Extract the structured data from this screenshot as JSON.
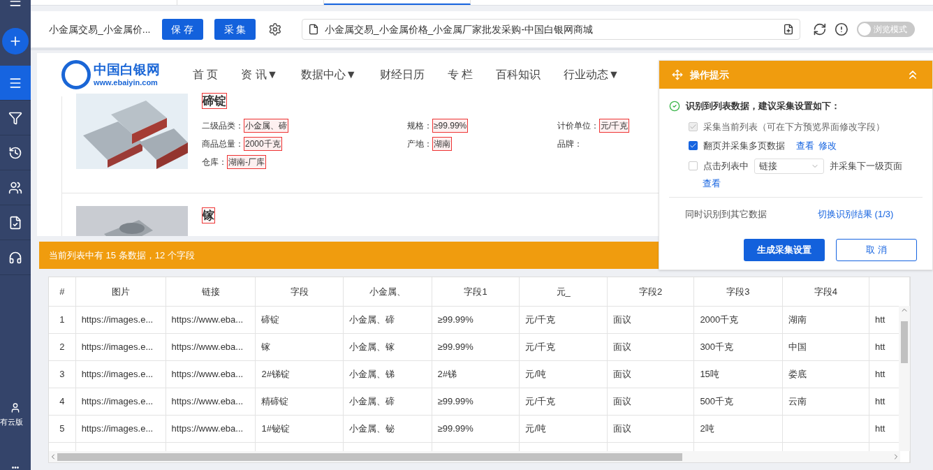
{
  "top_tabs": [
    {
      "selected": false
    },
    {
      "selected": false
    },
    {
      "selected": true
    }
  ],
  "toolbar": {
    "task_name": "小金属交易_小金属价...",
    "save": "保 存",
    "collect": "采 集",
    "url": "小金属交易_小金属价格_小金属厂家批发采购-中国白银网商城",
    "browse_mode": {
      "label": "浏览模式",
      "on": false
    }
  },
  "sidebar": {
    "items": [
      {
        "kind": "add"
      },
      {
        "kind": "list",
        "selected": true
      },
      {
        "kind": "filter",
        "selected": false
      },
      {
        "kind": "history",
        "selected": false
      },
      {
        "kind": "users",
        "selected": false
      },
      {
        "kind": "doc",
        "selected": false
      },
      {
        "kind": "support",
        "selected": false
      }
    ],
    "account": "有云版",
    "more": "•••"
  },
  "site": {
    "logo_name": "中国白银网",
    "logo_url": "www.ebaiyin.com",
    "nav": [
      "首 页",
      "资 讯▼",
      "数据中心▼",
      "财经日历",
      "专 栏",
      "百科知识",
      "行业动态▼"
    ]
  },
  "products": [
    {
      "title": "碲锭",
      "fields": [
        {
          "label": "二级品类：",
          "value": "小金属、碲"
        },
        {
          "label": "规格：",
          "value": "≥99.99%"
        },
        {
          "label": "计价单位：",
          "value": "元/千克"
        },
        {
          "label": "商品总量：",
          "value": "2000千克"
        },
        {
          "label": "产地：",
          "value": "湖南"
        },
        {
          "label": "品牌："
        },
        {
          "label": "仓库：",
          "value": "湖南-厂库"
        }
      ]
    },
    {
      "title": "镓"
    }
  ],
  "summary": "当前列表中有 15 条数据，12 个字段",
  "hint_panel": {
    "title": "操作提示",
    "status": "识别到列表数据，建议采集设置如下：",
    "options": [
      {
        "kind": "plain",
        "label": "采集当前列表（可在下方预览界面修改字段）",
        "checked": true,
        "disabled": true
      },
      {
        "kind": "links",
        "label": "翻页并采集多页数据",
        "checked": true,
        "disabled": false,
        "links": [
          "查看",
          "修改"
        ]
      },
      {
        "kind": "select",
        "label": "点击列表中",
        "select": "链接",
        "after": "并采集下一级页面",
        "checked": false,
        "disabled": false,
        "links": [
          "查看"
        ]
      }
    ],
    "other_label": "同时识别到其它数据",
    "switch_link": "切换识别结果 (1/3)",
    "primary": "生成采集设置",
    "cancel": "取 消"
  },
  "table": {
    "columns": [
      "#",
      "图片",
      "链接",
      "字段",
      "小金属、",
      "字段1",
      "元_",
      "字段2",
      "字段3",
      "字段4",
      ""
    ],
    "rows": [
      [
        "1",
        "https://images.e...",
        "https://www.eba...",
        "碲锭",
        "小金属、碲",
        "≥99.99%",
        "元/千克",
        "面议",
        "2000千克",
        "湖南",
        "htt"
      ],
      [
        "2",
        "https://images.e...",
        "https://www.eba...",
        "镓",
        "小金属、镓",
        "≥99.99%",
        "元/千克",
        "面议",
        "300千克",
        "中国",
        "htt"
      ],
      [
        "3",
        "https://images.e...",
        "https://www.eba...",
        "2#锑锭",
        "小金属、锑",
        "2#锑",
        "元/吨",
        "面议",
        "15吨",
        "娄底",
        "htt"
      ],
      [
        "4",
        "https://images.e...",
        "https://www.eba...",
        "精碲锭",
        "小金属、碲",
        "≥99.99%",
        "元/千克",
        "面议",
        "500千克",
        "云南",
        "htt"
      ],
      [
        "5",
        "https://images.e...",
        "https://www.eba...",
        "1#铋锭",
        "小金属、铋",
        "≥99.99%",
        "元/吨",
        "面议",
        "2吨",
        "",
        "htt"
      ]
    ]
  }
}
